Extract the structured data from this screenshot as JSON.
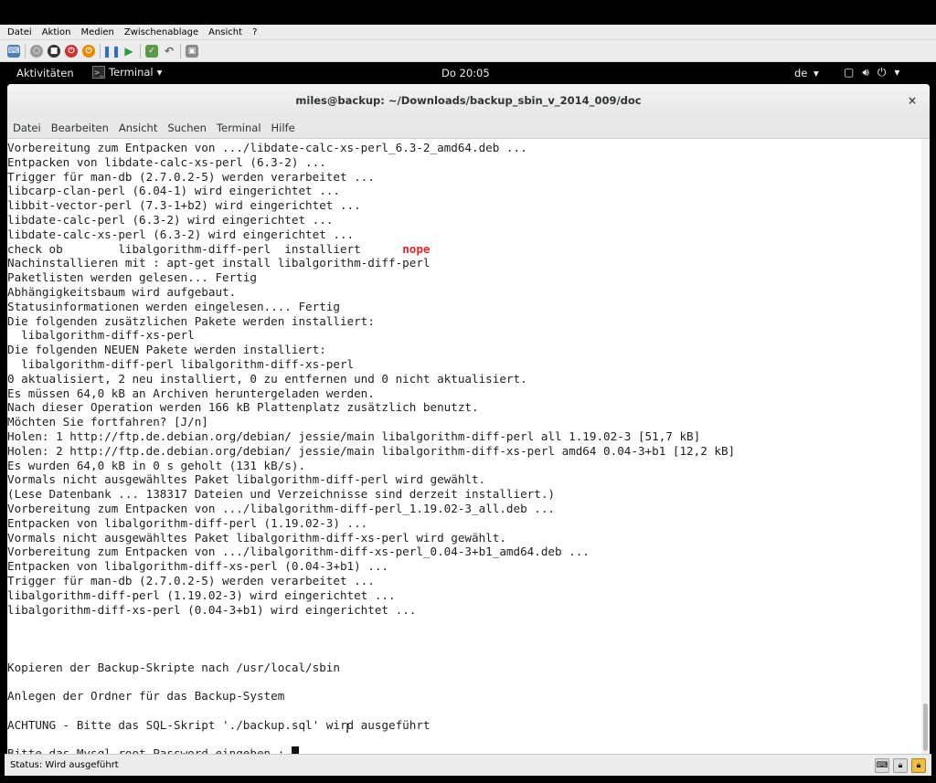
{
  "host_menu": [
    "Datei",
    "Aktion",
    "Medien",
    "Zwischenablage",
    "Ansicht",
    "?"
  ],
  "host_toolbar_icons": [
    "ctrl-alt-del-icon",
    "power-off-icon",
    "stop-icon",
    "shutdown-icon",
    "save-state-icon",
    "pause-icon",
    "resume-icon",
    "checkpoint-icon",
    "revert-icon",
    "enhanced-session-icon"
  ],
  "gnome": {
    "activities": "Aktivitäten",
    "app_menu": "Terminal",
    "clock": "Do 20:05",
    "lang": "de",
    "dropdown_arrow": "▾"
  },
  "window": {
    "title": "miles@backup: ~/Downloads/backup_sbin_v_2014_009/doc",
    "close": "×",
    "menu": [
      "Datei",
      "Bearbeiten",
      "Ansicht",
      "Suchen",
      "Terminal",
      "Hilfe"
    ]
  },
  "terminal": {
    "lines": [
      "Vorbereitung zum Entpacken von .../libdate-calc-xs-perl_6.3-2_amd64.deb ...",
      "Entpacken von libdate-calc-xs-perl (6.3-2) ...",
      "Trigger für man-db (2.7.0.2-5) werden verarbeitet ...",
      "libcarp-clan-perl (6.04-1) wird eingerichtet ...",
      "libbit-vector-perl (7.3-1+b2) wird eingerichtet ...",
      "libdate-calc-perl (6.3-2) wird eingerichtet ...",
      "libdate-calc-xs-perl (6.3-2) wird eingerichtet ...",
      "check ob        libalgorithm-diff-perl  installiert      ",
      "Nachinstallieren mit : apt-get install libalgorithm-diff-perl",
      "Paketlisten werden gelesen... Fertig",
      "Abhängigkeitsbaum wird aufgebaut.",
      "Statusinformationen werden eingelesen.... Fertig",
      "Die folgenden zusätzlichen Pakete werden installiert:",
      "  libalgorithm-diff-xs-perl",
      "Die folgenden NEUEN Pakete werden installiert:",
      "  libalgorithm-diff-perl libalgorithm-diff-xs-perl",
      "0 aktualisiert, 2 neu installiert, 0 zu entfernen und 0 nicht aktualisiert.",
      "Es müssen 64,0 kB an Archiven heruntergeladen werden.",
      "Nach dieser Operation werden 166 kB Plattenplatz zusätzlich benutzt.",
      "Möchten Sie fortfahren? [J/n]",
      "Holen: 1 http://ftp.de.debian.org/debian/ jessie/main libalgorithm-diff-perl all 1.19.02-3 [51,7 kB]",
      "Holen: 2 http://ftp.de.debian.org/debian/ jessie/main libalgorithm-diff-xs-perl amd64 0.04-3+b1 [12,2 kB]",
      "Es wurden 64,0 kB in 0 s geholt (131 kB/s).",
      "Vormals nicht ausgewähltes Paket libalgorithm-diff-perl wird gewählt.",
      "(Lese Datenbank ... 138317 Dateien und Verzeichnisse sind derzeit installiert.)",
      "Vorbereitung zum Entpacken von .../libalgorithm-diff-perl_1.19.02-3_all.deb ...",
      "Entpacken von libalgorithm-diff-perl (1.19.02-3) ...",
      "Vormals nicht ausgewähltes Paket libalgorithm-diff-xs-perl wird gewählt.",
      "Vorbereitung zum Entpacken von .../libalgorithm-diff-xs-perl_0.04-3+b1_amd64.deb ...",
      "Entpacken von libalgorithm-diff-xs-perl (0.04-3+b1) ...",
      "Trigger für man-db (2.7.0.2-5) werden verarbeitet ...",
      "libalgorithm-diff-perl (1.19.02-3) wird eingerichtet ...",
      "libalgorithm-diff-xs-perl (0.04-3+b1) wird eingerichtet ...",
      "",
      "",
      "",
      "Kopieren der Backup-Skripte nach /usr/local/sbin",
      "",
      "Anlegen der Ordner für das Backup-System",
      "",
      "ACHTUNG - Bitte das SQL-Skript './backup.sql' wird ausgeführt",
      "",
      "Bitte das Mysql root Password eingeben : "
    ],
    "nope_word": "nope"
  },
  "status": {
    "text": "Status: Wird ausgeführt"
  },
  "colors": {
    "nope": "#e2272a",
    "gnome_bar": "#000000",
    "terminal_bg": "#ffffff"
  }
}
